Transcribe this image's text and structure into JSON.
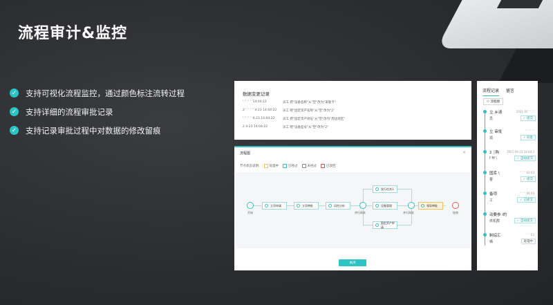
{
  "title": "流程审计&监控",
  "bullets": [
    "支持可视化流程监控，通过颜色标注流转过程",
    "支持详细的流程审批记录",
    "支持记录审批过程中对数据的修改留痕"
  ],
  "change_log": {
    "title": "数据变更记录",
    "rows": [
      {
        "time": "' ' ' ' ' '14:04:22",
        "text": "员工 把\"设备名称\"从\"空\"改为\"采集卡\""
      },
      {
        "time": "2' ' ' ' ' '4-23 14:04:22",
        "text": "员工 把\"固定资产名称\"从\"空\"改为\"2\""
      },
      {
        "time": "' ' ' ' ' '4-23 14:04:22",
        "text": "员工 把\"固定资产地址\"从\"空\"改为\"周边地区\""
      },
      {
        "time": "2     4-23 14:04:22",
        "text": "员工 把\"设备型号\"从\"空\"改为\"2\""
      }
    ]
  },
  "flow_dialog": {
    "title": "流程图",
    "close": "×",
    "legend_label": "节点状态说明:",
    "legend": [
      {
        "label": "处理中",
        "color": "#f0c060"
      },
      {
        "label": "已经过",
        "color": "#2bc3c3"
      },
      {
        "label": "未经过",
        "color": "#888888"
      },
      {
        "label": "已驳回",
        "color": "#e05a5a"
      }
    ],
    "start_label": "开始",
    "end_label": "结束",
    "nodes": {
      "n1": "立项申请",
      "n2": "立项审批",
      "n3": "风险分析",
      "p1": "发行任务1",
      "p2": "设备管理",
      "p3": "固定资产申请",
      "n4": "领导审批"
    },
    "gateway1": "并行网关",
    "gateway2": "并行网关",
    "confirm": "关闭"
  },
  "record_panel": {
    "tabs": [
      "流程记录",
      "留言"
    ],
    "flow_button": "流程图",
    "items": [
      {
        "name": "立  乡请",
        "time": "2021-05  ' ' ' '",
        "sub": "员",
        "badge": "提交"
      },
      {
        "name": "立  审批",
        "time": "' ' ' ' ' '",
        "sub": "领",
        "badge": "同意"
      },
      {
        "name": "2  ┆购",
        "time": "2021-04-23 14:04:2",
        "sub": "f  M  \\",
        "badge": "自动提交"
      },
      {
        "name": "国库  \\",
        "time": "' ' '   ' 03:03",
        "sub": "曹",
        "badge": "提交"
      },
      {
        "name": "备项",
        "time": "' ' '  ' 04:03",
        "sub": "工",
        "badge": "已提交"
      },
      {
        "name": "动要参  ⅰ的",
        "time": "",
        "sub": "供机群",
        "badge": "自动提交"
      },
      {
        "name": "制综汇",
        "time": "' ' ' 03",
        "sub": "栖",
        "badge": "处理中"
      }
    ]
  }
}
